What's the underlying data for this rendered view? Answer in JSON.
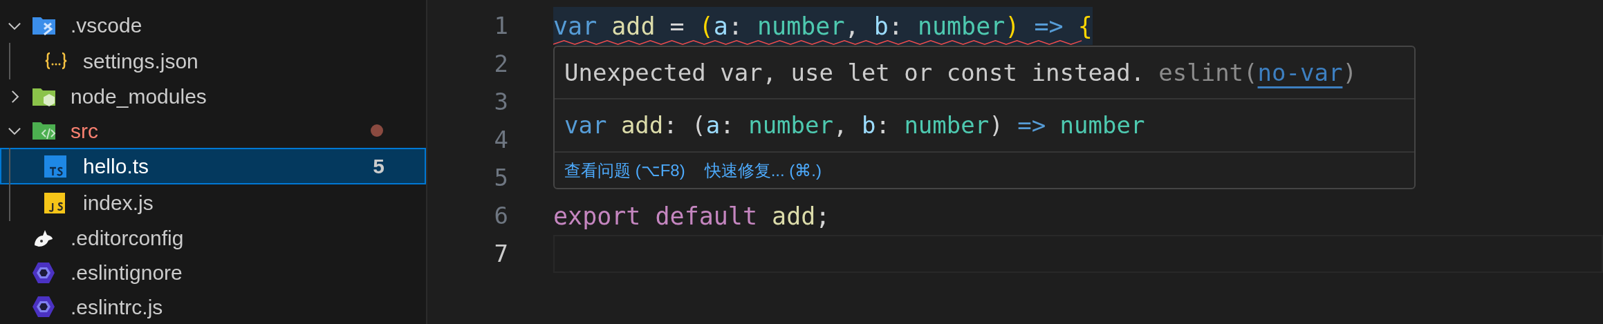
{
  "explorer": {
    "items": [
      {
        "name": ".vscode",
        "kind": "vscode",
        "expanded": true,
        "selected": false,
        "children": [
          {
            "name": "settings.json",
            "kind": "json",
            "selected": false
          }
        ]
      },
      {
        "name": "node_modules",
        "kind": "node",
        "expanded": false,
        "selected": false
      },
      {
        "name": "src",
        "kind": "source",
        "expanded": true,
        "selected": false,
        "error": true,
        "modified": true,
        "children": [
          {
            "name": "hello.ts",
            "kind": "ts",
            "selected": true,
            "problems": "5"
          },
          {
            "name": "index.js",
            "kind": "js",
            "selected": false
          }
        ]
      },
      {
        "name": ".editorconfig",
        "kind": "editorconfig",
        "selected": false
      },
      {
        "name": ".eslintignore",
        "kind": "eslint",
        "selected": false
      },
      {
        "name": ".eslintrc.js",
        "kind": "eslint",
        "selected": false
      }
    ]
  },
  "editor": {
    "lines": [
      {
        "number": "1",
        "highlighted": true,
        "error": true,
        "current": false,
        "tokens": [
          {
            "text": "var ",
            "kind": "keyword"
          },
          {
            "text": "add",
            "kind": "function"
          },
          {
            "text": " = ",
            "kind": "plain"
          },
          {
            "text": "(",
            "kind": "bracket"
          },
          {
            "text": "a",
            "kind": "param"
          },
          {
            "text": ": ",
            "kind": "plain"
          },
          {
            "text": "number",
            "kind": "type"
          },
          {
            "text": ", ",
            "kind": "plain"
          },
          {
            "text": "b",
            "kind": "param"
          },
          {
            "text": ": ",
            "kind": "plain"
          },
          {
            "text": "number",
            "kind": "type"
          },
          {
            "text": ")",
            "kind": "bracket"
          },
          {
            "text": " => ",
            "kind": "keyword"
          },
          {
            "text": "{",
            "kind": "bracket"
          }
        ]
      },
      {
        "number": "2",
        "current": false
      },
      {
        "number": "3",
        "current": false
      },
      {
        "number": "4",
        "current": false
      },
      {
        "number": "5",
        "current": false
      },
      {
        "number": "6",
        "highlighted": false,
        "error": false,
        "current": false,
        "tokens": [
          {
            "text": "export ",
            "kind": "control"
          },
          {
            "text": "default ",
            "kind": "control"
          },
          {
            "text": "add",
            "kind": "function"
          },
          {
            "text": ";",
            "kind": "plain"
          }
        ]
      },
      {
        "number": "7",
        "highlighted": false,
        "error": false,
        "current": true
      }
    ],
    "hover": {
      "message": "Unexpected var, use let or const instead.",
      "source": "eslint(",
      "code": "no-var",
      "source_end": ")",
      "signature": [
        {
          "text": "var ",
          "kind": "keyword"
        },
        {
          "text": "add",
          "kind": "function"
        },
        {
          "text": ": (",
          "kind": "plain"
        },
        {
          "text": "a",
          "kind": "param"
        },
        {
          "text": ": ",
          "kind": "plain"
        },
        {
          "text": "number",
          "kind": "type"
        },
        {
          "text": ", ",
          "kind": "plain"
        },
        {
          "text": "b",
          "kind": "param"
        },
        {
          "text": ": ",
          "kind": "plain"
        },
        {
          "text": "number",
          "kind": "type"
        },
        {
          "text": ") ",
          "kind": "plain"
        },
        {
          "text": "=> ",
          "kind": "keyword"
        },
        {
          "text": "number",
          "kind": "type"
        }
      ],
      "actions": [
        "查看问题 (⌥F8)",
        "快速修复... (⌘.)"
      ]
    }
  }
}
